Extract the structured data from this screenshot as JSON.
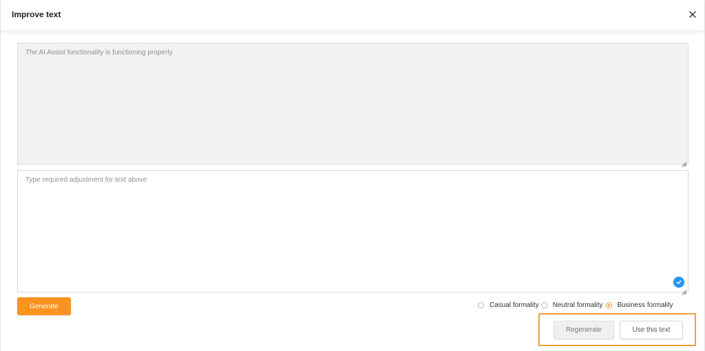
{
  "dialog": {
    "title": "Improve text",
    "close_icon": "close-icon"
  },
  "original": {
    "text": "The AI Assist functionality is functioning properly."
  },
  "adjustment": {
    "placeholder": "Type required adjustment for text above",
    "value": "",
    "check_icon": "check-circle-icon"
  },
  "actions": {
    "generate_label": "Generate",
    "regenerate_label": "Regenerate",
    "use_text_label": "Use this text"
  },
  "formality": {
    "options": [
      {
        "label": "Casual formality",
        "selected": false
      },
      {
        "label": "Neutral formality",
        "selected": false
      },
      {
        "label": "Business formality",
        "selected": true
      }
    ]
  },
  "colors": {
    "accent": "#f7931e",
    "check_badge": "#2196f3",
    "highlight": "#f39c3c"
  }
}
